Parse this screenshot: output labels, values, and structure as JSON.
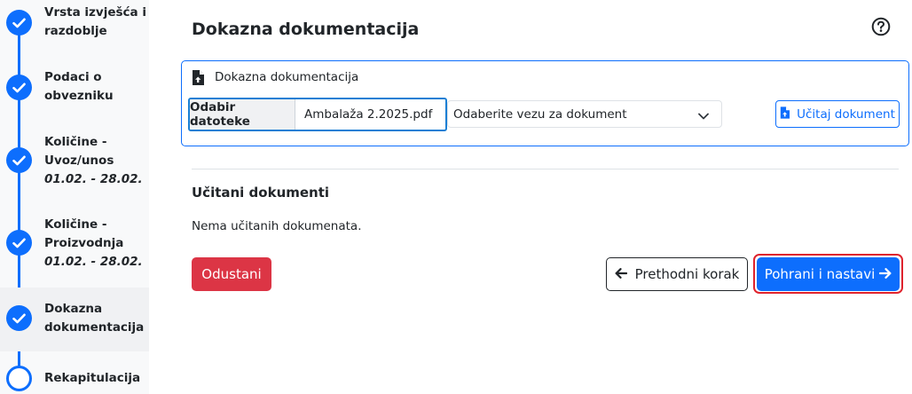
{
  "stepper": {
    "steps": [
      {
        "line1": "Vrsta izvješća i",
        "line2": "razdoblje",
        "dates": "",
        "status": "complete"
      },
      {
        "line1": "Podaci o",
        "line2": "obvezniku",
        "dates": "",
        "status": "complete"
      },
      {
        "line1": "Količine -",
        "line2": "Uvoz/unos",
        "dates": "01.02. - 28.02.",
        "status": "complete"
      },
      {
        "line1": "Količine -",
        "line2": "Proizvodnja",
        "dates": "01.02. - 28.02.",
        "status": "complete"
      },
      {
        "line1": "Dokazna",
        "line2": "dokumentacija",
        "dates": "",
        "status": "current"
      },
      {
        "line1": "Rekapitulacija",
        "line2": "",
        "dates": "",
        "status": "pending"
      }
    ]
  },
  "main": {
    "title": "Dokazna dokumentacija",
    "help_icon": "question-circle-icon",
    "upload": {
      "card_title": "Dokazna dokumentacija",
      "file_button": "Odabir datoteke",
      "file_name": "Ambalaža 2.2025.pdf",
      "select_value": "Odaberite vezu za dokument",
      "load_button": "Učitaj dokument"
    },
    "uploaded": {
      "title": "Učitani dokumenti",
      "empty_text": "Nema učitanih dokumenata."
    },
    "actions": {
      "cancel": "Odustani",
      "prev": "Prethodni korak",
      "save": "Pohrani i nastavi"
    }
  },
  "colors": {
    "primary": "#0d6efd",
    "danger": "#dc3545",
    "highlight": "#e0232d"
  }
}
